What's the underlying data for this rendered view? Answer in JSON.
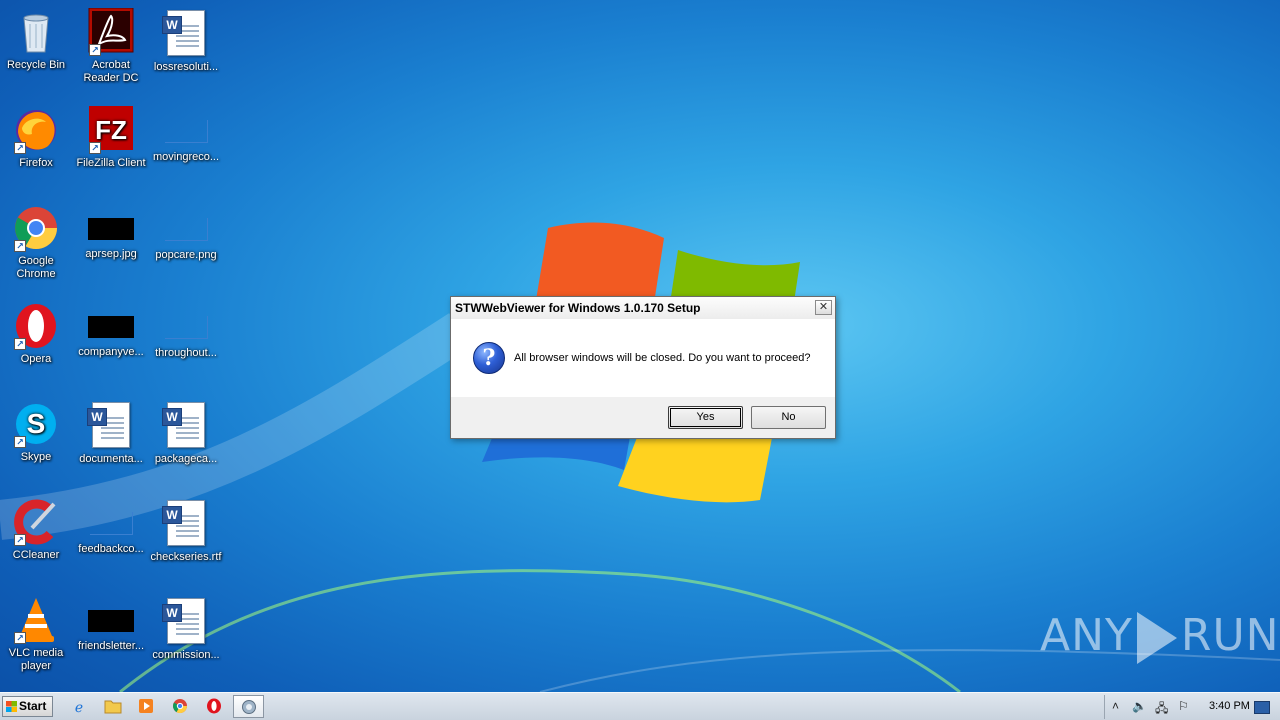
{
  "desktop": {
    "icons": [
      {
        "id": "recycle",
        "label": "Recycle Bin"
      },
      {
        "id": "acrobat",
        "label": "Acrobat Reader DC"
      },
      {
        "id": "lossres",
        "label": "lossresoluti..."
      },
      {
        "id": "firefox",
        "label": "Firefox"
      },
      {
        "id": "filezilla",
        "label": "FileZilla Client"
      },
      {
        "id": "movingreco",
        "label": "movingreco..."
      },
      {
        "id": "chrome",
        "label": "Google Chrome"
      },
      {
        "id": "aprsep",
        "label": "aprsep.jpg"
      },
      {
        "id": "popcare",
        "label": "popcare.png"
      },
      {
        "id": "opera",
        "label": "Opera"
      },
      {
        "id": "companyve",
        "label": "companyve..."
      },
      {
        "id": "throughout",
        "label": "throughout..."
      },
      {
        "id": "skype",
        "label": "Skype"
      },
      {
        "id": "documenta",
        "label": "documenta..."
      },
      {
        "id": "packageca",
        "label": "packageca..."
      },
      {
        "id": "ccleaner",
        "label": "CCleaner"
      },
      {
        "id": "feedbackco",
        "label": "feedbackco..."
      },
      {
        "id": "checkseries",
        "label": "checkseries.rtf"
      },
      {
        "id": "vlc",
        "label": "VLC media player"
      },
      {
        "id": "friendsletter",
        "label": "friendsletter..."
      },
      {
        "id": "commission",
        "label": "commission..."
      }
    ]
  },
  "dialog": {
    "title": "STWWebViewer for Windows 1.0.170 Setup",
    "close_symbol": "✕",
    "message": "All browser windows will be closed. Do you want to proceed?",
    "yes_label": "Yes",
    "no_label": "No"
  },
  "watermark": {
    "left": "ANY",
    "right": "RUN"
  },
  "taskbar": {
    "start_label": "Start",
    "clock": "3:40 PM"
  },
  "colors": {
    "wallpaper": "#1a7fd0",
    "dialog_bg": "#f0f0f0",
    "taskbar": "#c9d3de"
  }
}
